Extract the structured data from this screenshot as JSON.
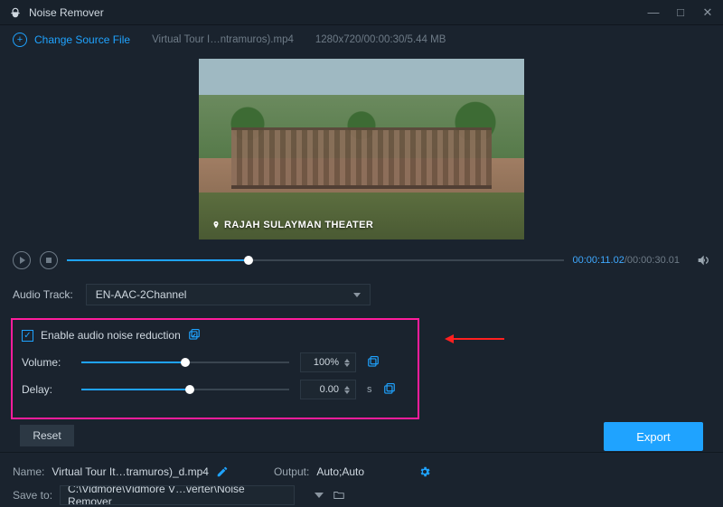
{
  "app": {
    "title": "Noise Remover"
  },
  "top": {
    "change_source": "Change Source File",
    "file_name": "Virtual Tour I…ntramuros).mp4",
    "file_meta": "1280x720/00:00:30/5.44 MB"
  },
  "preview": {
    "caption": "RAJAH SULAYMAN THEATER"
  },
  "transport": {
    "current": "00:00:11.02",
    "total": "00:00:30.01",
    "progress_pct": 36.6
  },
  "audio_track": {
    "label": "Audio Track:",
    "selected": "EN-AAC-2Channel"
  },
  "noise": {
    "enable_label": "Enable audio noise reduction",
    "enabled": true,
    "volume_label": "Volume:",
    "volume_value": "100%",
    "volume_pct": 50,
    "delay_label": "Delay:",
    "delay_value": "0.00",
    "delay_unit": "s",
    "delay_pct": 52,
    "reset_label": "Reset"
  },
  "output": {
    "name_label": "Name:",
    "name_value": "Virtual Tour It…tramuros)_d.mp4",
    "output_label": "Output:",
    "output_value": "Auto;Auto",
    "save_label": "Save to:",
    "save_path": "C:\\Vidmore\\Vidmore V…verter\\Noise Remover"
  },
  "export_label": "Export"
}
